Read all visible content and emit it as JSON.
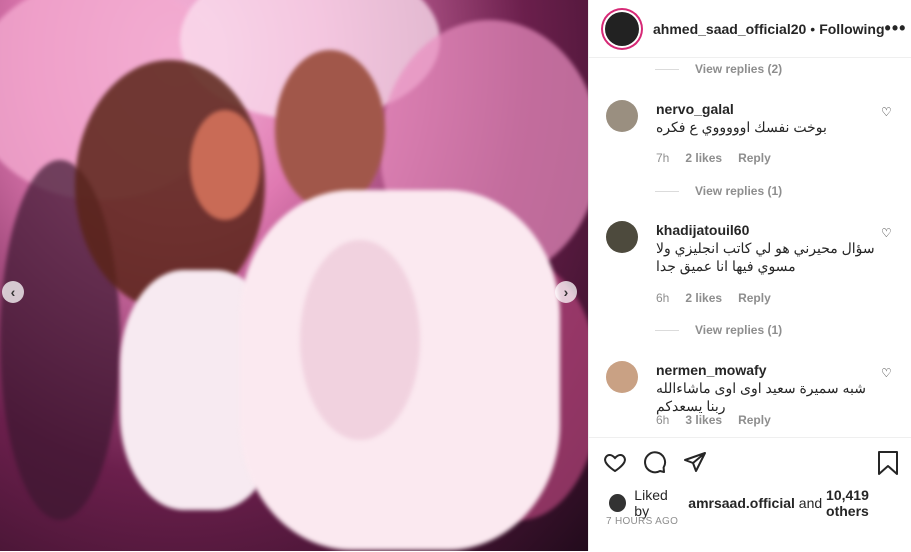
{
  "post": {
    "username": "ahmed_saad_official20",
    "separator": "•",
    "follow_status": "Following",
    "more_glyph": "•••"
  },
  "photo": {
    "prev_glyph": "‹",
    "next_glyph": "›"
  },
  "comments": [
    {
      "username": "nervo_galal",
      "text": "بوخت نفسك اوووووي ع فكره",
      "age": "7h",
      "likes": "2 likes",
      "reply": "Reply",
      "replies_label": "View replies (1)",
      "avatar_color": "#9a8f80"
    },
    {
      "username": "khadijatouil60",
      "text": "سؤال محيرني هو لي كاتب انجليزي ولا مسوي فيها انا عميق جدا",
      "age": "6h",
      "likes": "2 likes",
      "reply": "Reply",
      "replies_label": "View replies (1)",
      "avatar_color": "#4d4a3d"
    },
    {
      "username": "nermen_mowafy",
      "text": "شبه سميرة سعيد اوى اوى ماشاءالله ربنا يسعدكم",
      "age": "6h",
      "likes": "3 likes",
      "reply": "Reply",
      "avatar_color": "#c9a184"
    }
  ],
  "top_replies_label": "View replies (2)",
  "likes": {
    "prefix": "Liked by",
    "user": "amrsaad.official",
    "and": "and",
    "count": "10,419 others"
  },
  "timestamp": "7 HOURS AGO"
}
